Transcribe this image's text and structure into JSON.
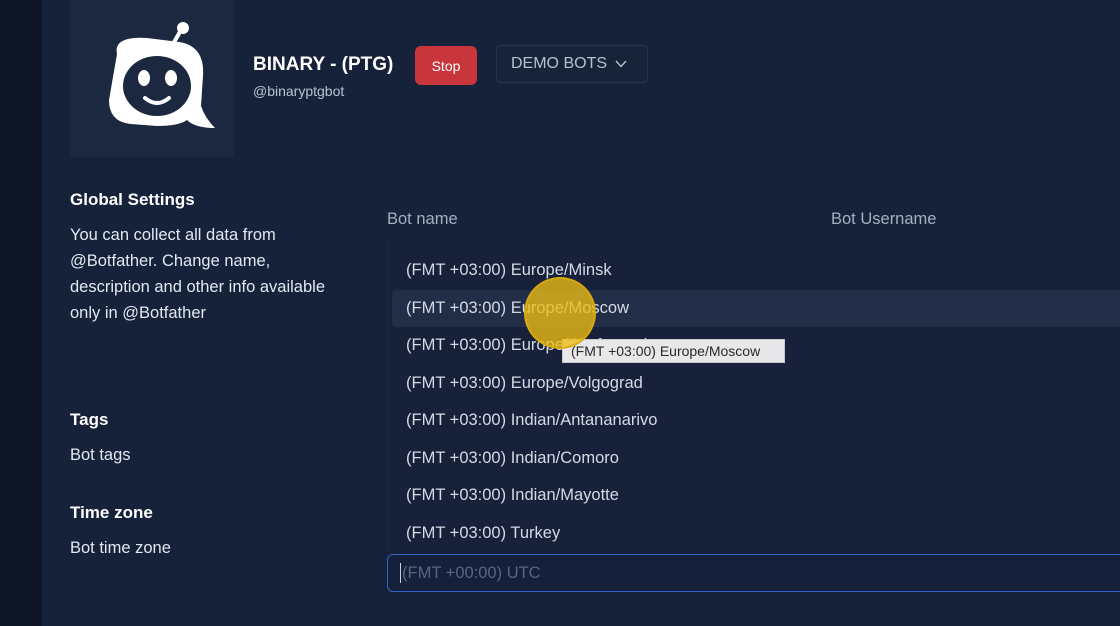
{
  "bot": {
    "title": "BINARY - (PTG)",
    "handle": "@binaryptgbot",
    "stop_label": "Stop",
    "demo_label": "DEMO BOTS"
  },
  "global_settings": {
    "title": "Global Settings",
    "description": "You can collect all data from @Botfather. Change name, description and other info available only in @Botfather"
  },
  "tags": {
    "title": "Tags",
    "description": "Bot tags"
  },
  "time_zone": {
    "title": "Time zone",
    "description": "Bot time zone"
  },
  "columns": {
    "bot_name": "Bot name",
    "bot_username": "Bot Username"
  },
  "timezone_options": [
    "(FMT +03:00) Europe/Minsk",
    "(FMT +03:00) Europe/Moscow",
    "(FMT +03:00) Europe/Simferopol",
    "(FMT +03:00) Europe/Volgograd",
    "(FMT +03:00) Indian/Antananarivo",
    "(FMT +03:00) Indian/Comoro",
    "(FMT +03:00) Indian/Mayotte",
    "(FMT +03:00) Turkey"
  ],
  "highlighted_index": 1,
  "tooltip_text": "(FMT +03:00) Europe/Moscow",
  "timezone_input": {
    "placeholder": "(FMT +00:00) UTC"
  },
  "colors": {
    "background": "#16223a",
    "stop_button": "#c8353b",
    "input_focus_border": "#3562c8",
    "cursor_highlight": "#eebe14"
  }
}
